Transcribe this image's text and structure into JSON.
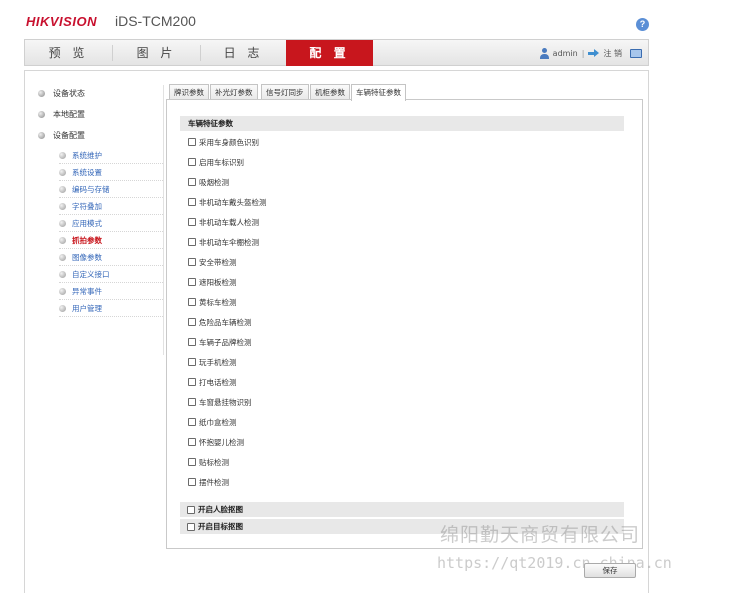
{
  "header": {
    "brand": "HIKVISION",
    "model": "iDS-TCM200",
    "help_icon_glyph": "?"
  },
  "nav": {
    "tabs": [
      "预 览",
      "图 片",
      "日 志",
      "配 置"
    ],
    "active_tab": "配 置",
    "user": "admin",
    "separator": "|",
    "logout": "注 销"
  },
  "sidebar": {
    "items": [
      "设备状态",
      "本地配置",
      "设备配置"
    ],
    "sub_items": [
      "系统维护",
      "系统设置",
      "编码与存储",
      "字符叠加",
      "应用模式",
      "抓拍参数",
      "图像参数",
      "自定义接口",
      "异常事件",
      "用户管理"
    ],
    "active_sub_item": "抓拍参数"
  },
  "tabs": [
    "牌识参数",
    "补光灯参数",
    "信号灯同步",
    "机柜参数",
    "车辆特征参数"
  ],
  "active_tab": "车辆特征参数",
  "section": {
    "title": "车辆特征参数",
    "options": [
      "采用车身颜色识别",
      "启用车标识别",
      "吸烟检测",
      "非机动车戴头盔检测",
      "非机动车载人检测",
      "非机动车伞棚检测",
      "安全带检测",
      "遮阳板检测",
      "黄标车检测",
      "危险品车辆检测",
      "车辆子品牌检测",
      "玩手机检测",
      "打电话检测",
      "车窗悬挂物识别",
      "纸巾盒检测",
      "怀抱婴儿检测",
      "贴标检测",
      "摆件检测"
    ]
  },
  "extra_sections": [
    "开启人脸抠图",
    "开启目标抠图"
  ],
  "save_label": "保存",
  "watermark": {
    "line1": "绵阳勤天商贸有限公司",
    "line2": "https://qt2019.cn.china.cn"
  },
  "colors": {
    "brand_red": "#c8102e",
    "active_nav": "#c8161d",
    "link_blue": "#3366b8"
  }
}
